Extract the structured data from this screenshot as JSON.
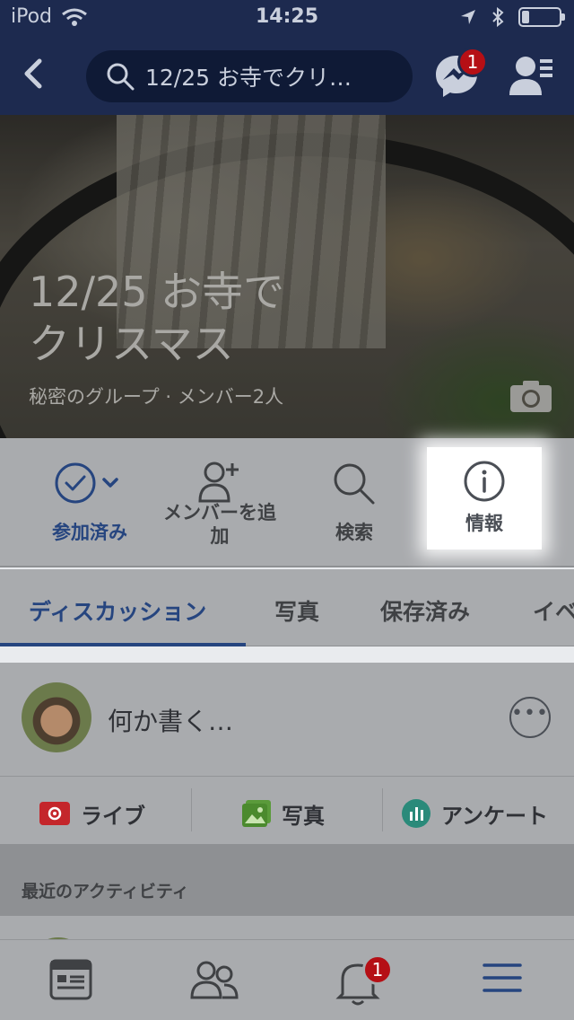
{
  "status_bar": {
    "carrier": "iPod",
    "time": "14:25",
    "battery_level": 0.2
  },
  "header": {
    "search_text": "12/25 お寺でクリ…",
    "messenger_badge": "1"
  },
  "group": {
    "name": "12/25 お寺で\nクリスマス",
    "meta": "秘密のグループ · メンバー2人"
  },
  "actions": [
    {
      "label": "参加済み",
      "icon": "check-circle-icon"
    },
    {
      "label": "メンバーを追\n加",
      "icon": "add-person-icon"
    },
    {
      "label": "検索",
      "icon": "search-icon"
    },
    {
      "label": "情報",
      "icon": "info-icon"
    }
  ],
  "tabs": [
    {
      "label": "ディスカッション",
      "active": true
    },
    {
      "label": "写真"
    },
    {
      "label": "保存済み"
    },
    {
      "label": "イベ"
    }
  ],
  "composer": {
    "placeholder": "何か書く…",
    "buttons": [
      {
        "label": "ライブ",
        "icon": "live-video-icon",
        "color": "#c4262b"
      },
      {
        "label": "写真",
        "icon": "photo-icon",
        "color": "#4b8a2e"
      },
      {
        "label": "アンケート",
        "icon": "poll-icon",
        "color": "#2a8a7a"
      }
    ]
  },
  "recent_activity": {
    "label": "最近のアクティビティ"
  },
  "bottom_nav": {
    "notification_badge": "1"
  },
  "colors": {
    "nav_bg": "#1d2a4f",
    "accent": "#26457f",
    "badge": "#b50f15"
  }
}
